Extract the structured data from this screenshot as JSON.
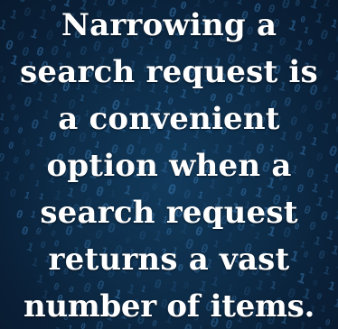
{
  "quote": {
    "lines": [
      "Narrowing a",
      "search request is",
      "a convenient",
      "option when a",
      "search request",
      "returns a vast",
      "number of items."
    ]
  },
  "background": {
    "base_color": "#0d2c48",
    "digit_color": "#3f86c4",
    "description_icon": "binary-digits-pattern"
  },
  "colors": {
    "text": "#ffffff"
  }
}
